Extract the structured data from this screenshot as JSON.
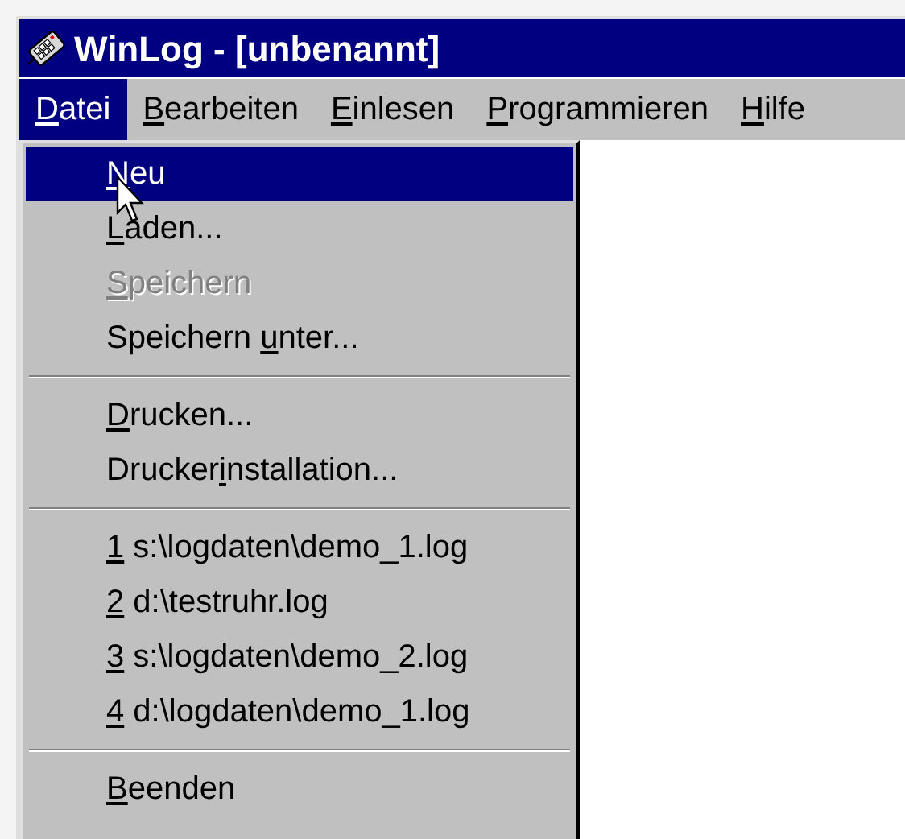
{
  "window": {
    "title": "WinLog - [unbenannt]"
  },
  "menu_bar": [
    {
      "key": "D",
      "post": "atei",
      "selected": true
    },
    {
      "key": "B",
      "post": "earbeiten",
      "selected": false
    },
    {
      "key": "E",
      "post": "inlesen",
      "selected": false
    },
    {
      "key": "P",
      "post": "rogrammieren",
      "selected": false
    },
    {
      "key": "H",
      "post": "ilfe",
      "selected": false
    }
  ],
  "dropdown": [
    {
      "kind": "item",
      "key": "N",
      "post": "eu",
      "selected": true,
      "disabled": false
    },
    {
      "kind": "item",
      "key": "L",
      "post": "aden...",
      "selected": false,
      "disabled": false
    },
    {
      "kind": "item",
      "key": "S",
      "post": "peichern",
      "selected": false,
      "disabled": true
    },
    {
      "kind": "item",
      "pre": "Speichern ",
      "key": "u",
      "post": "nter...",
      "selected": false,
      "disabled": false
    },
    {
      "kind": "separator"
    },
    {
      "kind": "item",
      "key": "D",
      "post": "rucken...",
      "selected": false,
      "disabled": false
    },
    {
      "kind": "item",
      "pre": "Drucker",
      "key": "i",
      "post": "nstallation...",
      "selected": false,
      "disabled": false
    },
    {
      "kind": "separator"
    },
    {
      "kind": "item",
      "key": "1",
      "post": " s:\\logdaten\\demo_1.log",
      "selected": false,
      "disabled": false
    },
    {
      "kind": "item",
      "key": "2",
      "post": " d:\\testruhr.log",
      "selected": false,
      "disabled": false
    },
    {
      "kind": "item",
      "key": "3",
      "post": " s:\\logdaten\\demo_2.log",
      "selected": false,
      "disabled": false
    },
    {
      "kind": "item",
      "key": "4",
      "post": " d:\\logdaten\\demo_1.log",
      "selected": false,
      "disabled": false
    },
    {
      "kind": "separator"
    },
    {
      "kind": "item",
      "key": "B",
      "post": "eenden",
      "selected": false,
      "disabled": false
    }
  ]
}
